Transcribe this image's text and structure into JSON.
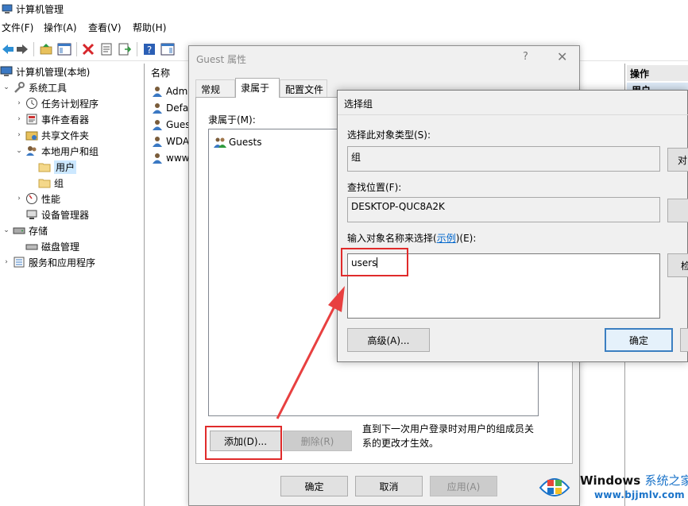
{
  "window": {
    "title": "计算机管理"
  },
  "menu": [
    "文件(F)",
    "操作(A)",
    "查看(V)",
    "帮助(H)"
  ],
  "tree": {
    "items": [
      {
        "label": "计算机管理(本地)",
        "icon": "computer-mgmt-icon"
      },
      {
        "label": "系统工具",
        "icon": "tools-icon"
      },
      {
        "label": "任务计划程序",
        "icon": "clock-icon"
      },
      {
        "label": "事件查看器",
        "icon": "event-viewer-icon"
      },
      {
        "label": "共享文件夹",
        "icon": "shared-folder-icon"
      },
      {
        "label": "本地用户和组",
        "icon": "users-icon"
      },
      {
        "label": "用户",
        "icon": "folder-icon"
      },
      {
        "label": "组",
        "icon": "folder-icon"
      },
      {
        "label": "性能",
        "icon": "performance-icon"
      },
      {
        "label": "设备管理器",
        "icon": "device-manager-icon"
      },
      {
        "label": "存储",
        "icon": "storage-icon"
      },
      {
        "label": "磁盘管理",
        "icon": "disk-icon"
      },
      {
        "label": "服务和应用程序",
        "icon": "services-icon"
      }
    ]
  },
  "list": {
    "header": "名称",
    "rows": [
      "Admi",
      "Defa",
      "Guest",
      "WDA",
      "www."
    ]
  },
  "actions": {
    "header": "操作",
    "item": "用户"
  },
  "guest_dialog": {
    "title": "Guest 属性",
    "help": "?",
    "close": "✕",
    "tabs": [
      "常规",
      "隶属于",
      "配置文件"
    ],
    "member_label": "隶属于(M):",
    "members": [
      "Guests"
    ],
    "add_button": "添加(D)...",
    "remove_button": "删除(R)",
    "note": "直到下一次用户登录时对用户的组成员关系的更改才生效。",
    "ok_button": "确定",
    "cancel_button": "取消",
    "apply_button": "应用(A)"
  },
  "select_dialog": {
    "title": "选择组",
    "object_type_label": "选择此对象类型(S):",
    "object_type_value": "组",
    "object_type_button": "对",
    "location_label": "查找位置(F):",
    "location_value": "DESKTOP-QUC8A2K",
    "names_label_prefix": "输入对象名称来选择(",
    "names_label_link": "示例",
    "names_label_suffix": ")(E):",
    "names_value": "users",
    "check_button": "检",
    "advanced_button": "高级(A)...",
    "ok_button": "确定"
  },
  "watermark": {
    "brand": "Windows",
    "brand_cn": "系统之家",
    "url": "www.bjjmlv.com"
  },
  "colors": {
    "highlight": "#e02b2b",
    "arrow": "#e84040",
    "selection": "#cce8ff",
    "accent": "#3c7fc1"
  }
}
